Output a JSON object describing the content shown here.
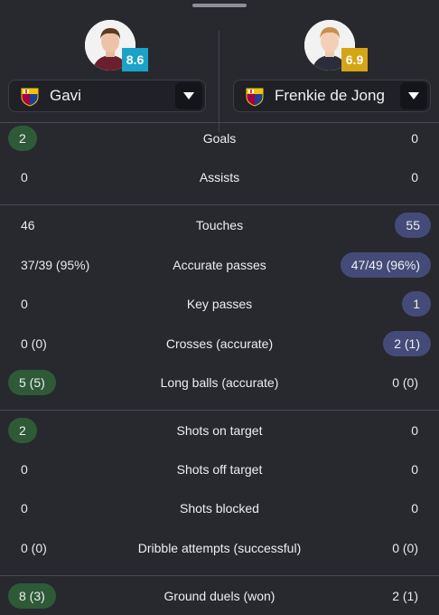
{
  "colors": {
    "background": "#27292f",
    "win_left": "#2e5a38",
    "win_right": "#444b78",
    "rating_left": "#1aa3c7",
    "rating_right": "#d6a514"
  },
  "players": {
    "left": {
      "name": "Gavi",
      "rating": "8.6",
      "club_icon": "fc-barcelona-crest-icon"
    },
    "right": {
      "name": "Frenkie de Jong",
      "rating": "6.9",
      "club_icon": "fc-barcelona-crest-icon"
    }
  },
  "stats": [
    {
      "label": "Goals",
      "left": "2",
      "right": "0",
      "winner": "left"
    },
    {
      "label": "Assists",
      "left": "0",
      "right": "0",
      "winner": "none"
    },
    {
      "label": "Touches",
      "left": "46",
      "right": "55",
      "winner": "right"
    },
    {
      "label": "Accurate passes",
      "left": "37/39 (95%)",
      "right": "47/49 (96%)",
      "winner": "right"
    },
    {
      "label": "Key passes",
      "left": "0",
      "right": "1",
      "winner": "right"
    },
    {
      "label": "Crosses (accurate)",
      "left": "0 (0)",
      "right": "2 (1)",
      "winner": "right"
    },
    {
      "label": "Long balls (accurate)",
      "left": "5 (5)",
      "right": "0 (0)",
      "winner": "left"
    },
    {
      "label": "Shots on target",
      "left": "2",
      "right": "0",
      "winner": "left"
    },
    {
      "label": "Shots off target",
      "left": "0",
      "right": "0",
      "winner": "none"
    },
    {
      "label": "Shots blocked",
      "left": "0",
      "right": "0",
      "winner": "none"
    },
    {
      "label": "Dribble attempts (successful)",
      "left": "0 (0)",
      "right": "0 (0)",
      "winner": "none"
    },
    {
      "label": "Ground duels (won)",
      "left": "8 (3)",
      "right": "2 (1)",
      "winner": "left"
    }
  ]
}
